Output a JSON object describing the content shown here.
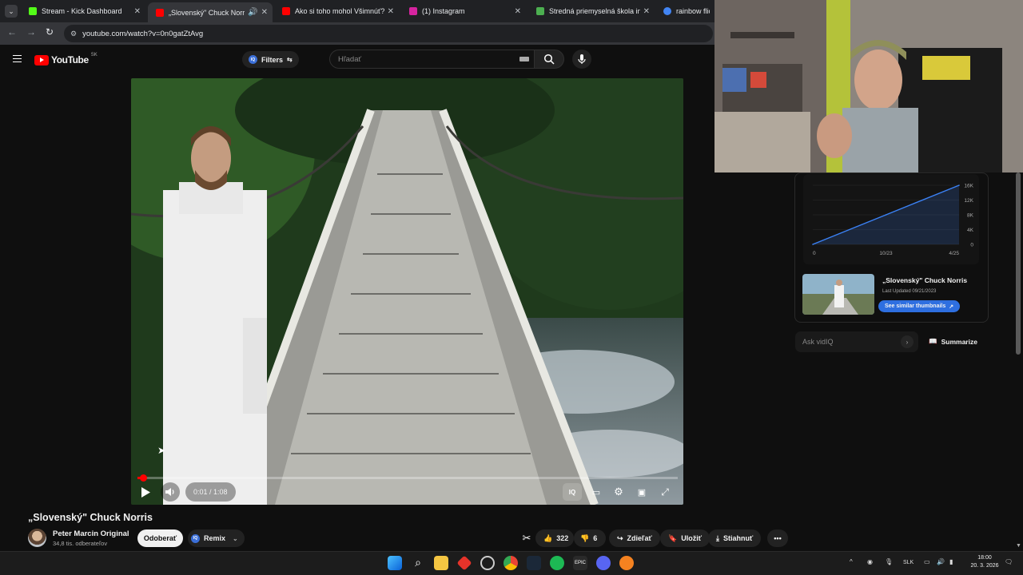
{
  "browser": {
    "tabs": [
      {
        "title": "Stream - Kick Dashboard",
        "favicon": "kick-icon",
        "color": "#53fc18"
      },
      {
        "title": "„Slovenský\" Chuck Norris -",
        "favicon": "youtube-icon",
        "color": "#ff0000",
        "active": true
      },
      {
        "title": "Ako si toho mohol Všimnúť?",
        "favicon": "youtube-icon",
        "color": "#ff0000"
      },
      {
        "title": "(1) Instagram",
        "favicon": "instagram-icon",
        "color": "#d6249f"
      },
      {
        "title": "Stredná priemyselná škola infor",
        "favicon": "page-icon",
        "color": "#4caf50"
      },
      {
        "title": "rainbow flick -",
        "favicon": "google-icon",
        "color": "#4285f4"
      }
    ],
    "url": "youtube.com/watch?v=0n0gatZtAvg"
  },
  "youtube": {
    "logo_text": "YouTube",
    "country": "SK",
    "filters_label": "Filters",
    "search_placeholder": "Hľadať"
  },
  "player": {
    "time": "0:01 / 1:08",
    "progress": 0.015,
    "iq_label": "IQ"
  },
  "video": {
    "title": "„Slovenský\" Chuck Norris",
    "channel": "Peter Marcin Original",
    "subscribers": "34,8 tis. odberateľov",
    "subscribe_label": "Odoberať",
    "remix_label": "Remix",
    "likes": "322",
    "dislikes": "6",
    "share_label": "Zdieľať",
    "save_label": "Uložiť",
    "download_label": "Stiahnuť"
  },
  "vidiq": {
    "thumb_title": "„Slovenský\" Chuck Norris",
    "last_updated": "Last Updated 09/21/2023",
    "similar_label": "See similar thumbnails",
    "ask_placeholder": "Ask vidIQ",
    "summarize_label": "Summarize"
  },
  "chart_data": {
    "type": "line",
    "x": [
      "0",
      "10/23",
      "4/25"
    ],
    "series": [
      {
        "values": [
          0,
          8000,
          16000
        ]
      }
    ],
    "yticks": [
      "16K",
      "12K",
      "8K",
      "4K",
      "0"
    ],
    "ylim": [
      0,
      16000
    ],
    "grid": true,
    "color": "#3b82f6"
  },
  "taskbar": {
    "language": "SLK",
    "time": "18:00",
    "date": "20. 3. 2026"
  }
}
